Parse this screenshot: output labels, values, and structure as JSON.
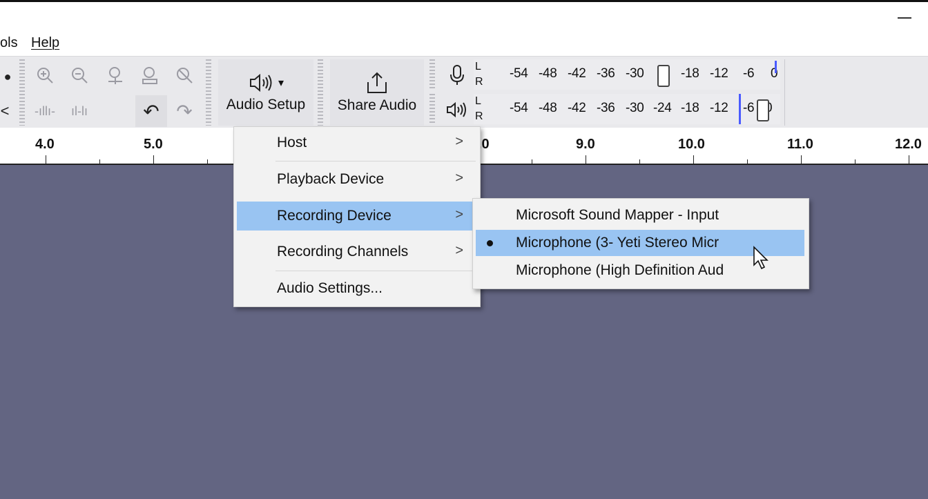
{
  "menubar": {
    "tools_partial": "ols",
    "help": "Help"
  },
  "toolbar": {
    "audio_setup_label": "Audio Setup",
    "share_audio_label": "Share Audio",
    "dropdown_arrow": "▾"
  },
  "meters": {
    "record": {
      "channels": [
        "L",
        "R"
      ],
      "ticks": [
        "-54",
        "-48",
        "-42",
        "-36",
        "-30",
        "-18",
        "-12",
        "-6",
        "0"
      ]
    },
    "playback": {
      "channels": [
        "L",
        "R"
      ],
      "ticks": [
        "-54",
        "-48",
        "-42",
        "-36",
        "-30",
        "-24",
        "-18",
        "-12",
        "-6",
        "0"
      ]
    }
  },
  "ruler": {
    "labels": [
      "4.0",
      "5.0",
      ".0",
      "9.0",
      "10.0",
      "11.0",
      "12.0"
    ]
  },
  "audio_setup_menu": {
    "items": [
      {
        "label": "Host",
        "submenu_arrow": ">"
      },
      {
        "label": "Playback Device",
        "submenu_arrow": ">"
      },
      {
        "label": "Recording Device",
        "submenu_arrow": ">"
      },
      {
        "label": "Recording Channels",
        "submenu_arrow": ">"
      },
      {
        "label": "Audio Settings...",
        "submenu_arrow": ""
      }
    ]
  },
  "recording_device_menu": {
    "items": [
      {
        "label": "Microsoft Sound Mapper - Input"
      },
      {
        "label": "Microphone (3- Yeti Stereo Micr"
      },
      {
        "label": "Microphone (High Definition Aud"
      }
    ]
  },
  "colors": {
    "track_background": "#636582",
    "menu_highlight": "#99c4f2",
    "toolbar_background": "#e9e9ec"
  }
}
